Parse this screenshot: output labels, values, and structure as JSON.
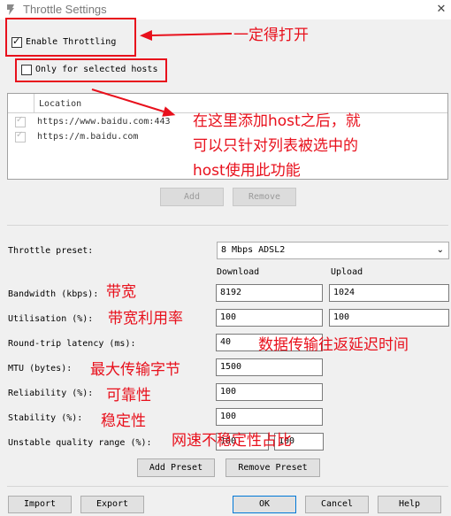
{
  "window": {
    "title": "Throttle Settings"
  },
  "enable_throttling": {
    "label": "Enable Throttling",
    "checked": true
  },
  "only_selected_hosts": {
    "label": "Only for selected hosts",
    "checked": false
  },
  "hosts_table": {
    "column": "Location",
    "rows": [
      {
        "checked": true,
        "location": "https://www.baidu.com:443"
      },
      {
        "checked": true,
        "location": "https://m.baidu.com"
      }
    ]
  },
  "buttons": {
    "add": "Add",
    "remove": "Remove",
    "add_preset": "Add Preset",
    "remove_preset": "Remove Preset",
    "import": "Import",
    "export": "Export",
    "ok": "OK",
    "cancel": "Cancel",
    "help": "Help"
  },
  "preset": {
    "label": "Throttle preset:",
    "value": "8 Mbps ADSL2"
  },
  "columns": {
    "download": "Download",
    "upload": "Upload"
  },
  "fields": {
    "bandwidth": {
      "label": "Bandwidth (kbps):",
      "download": "8192",
      "upload": "1024"
    },
    "utilisation": {
      "label": "Utilisation (%):",
      "download": "100",
      "upload": "100"
    },
    "latency": {
      "label": "Round-trip latency (ms):",
      "value": "40"
    },
    "mtu": {
      "label": "MTU (bytes):",
      "value": "1500"
    },
    "reliability": {
      "label": "Reliability (%):",
      "value": "100"
    },
    "stability": {
      "label": "Stability (%):",
      "value": "100"
    },
    "unstable": {
      "label": "Unstable quality range (%):",
      "min": "100",
      "max": "100"
    }
  },
  "annotations": {
    "must_enable": "一定得打开",
    "hosts_note_1": "在这里添加host之后，就",
    "hosts_note_2": "可以只针对列表被选中的",
    "hosts_note_3": "host使用此功能",
    "bandwidth": "带宽",
    "utilisation": "带宽利用率",
    "latency": "数据传输往返延迟时间",
    "mtu": "最大传输字节",
    "reliability": "可靠性",
    "stability": "稳定性",
    "unstable": "网速不稳定性占比"
  },
  "colors": {
    "annotation_red": "#e8101c",
    "focus_blue": "#0078d7"
  }
}
